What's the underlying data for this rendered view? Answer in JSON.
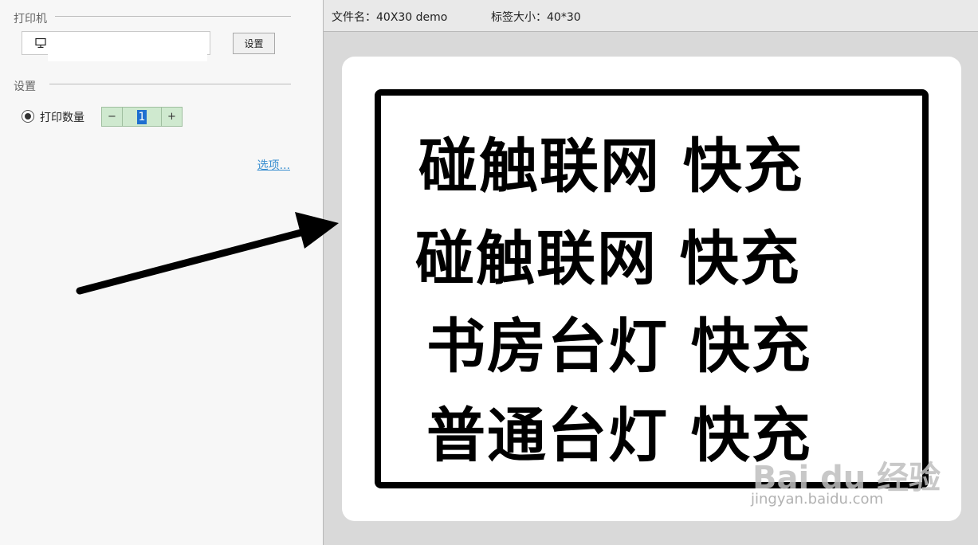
{
  "printer_group": {
    "title": "打印机",
    "setup_label": "设置"
  },
  "settings_group": {
    "title": "设置",
    "print_count_label": "打印数量",
    "minus": "−",
    "plus": "+",
    "count_value": "1",
    "options_link": "选项..."
  },
  "info_bar": {
    "file_name": "文件名：40X30 demo",
    "label_size": "标签大小：40*30"
  },
  "label": {
    "lines": [
      "碰触联网  快充",
      "碰触联网  快充",
      "书房台灯  快充",
      "普通台灯  快充"
    ]
  },
  "watermark": {
    "brand": "Bai du 经验",
    "url": "jingyan.baidu.com"
  },
  "colors": {
    "stepper_bg": "#cfe9cf",
    "link": "#3a8fd0",
    "selection": "#1e6fd0"
  }
}
